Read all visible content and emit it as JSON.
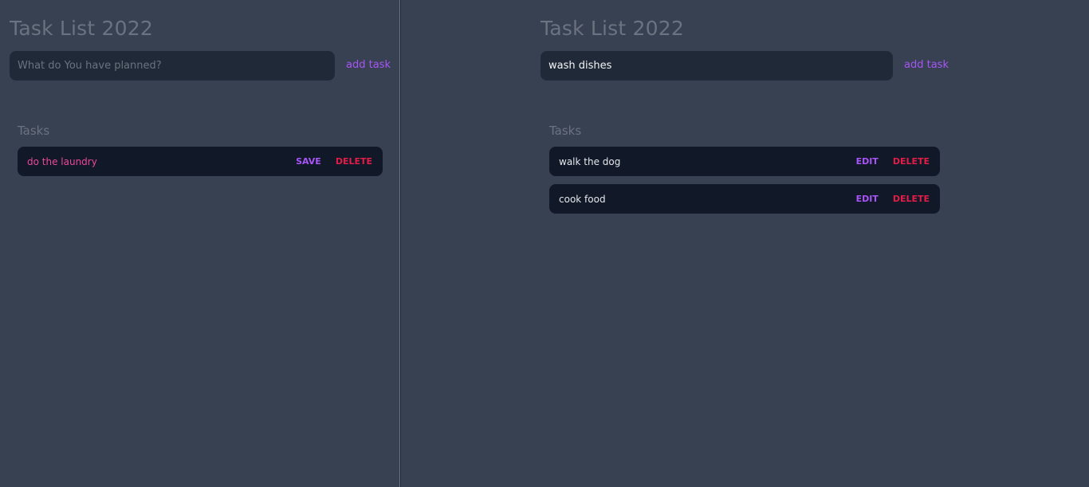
{
  "left": {
    "title": "Task List 2022",
    "input": {
      "value": "",
      "placeholder": "What do You have planned?"
    },
    "add_label": "add task",
    "section_label": "Tasks",
    "tasks": [
      {
        "text": "do the laundry",
        "primary_label": "SAVE",
        "delete_label": "DELETE"
      }
    ]
  },
  "right": {
    "title": "Task List 2022",
    "input": {
      "value": "wash dishes",
      "placeholder": ""
    },
    "add_label": "add task",
    "section_label": "Tasks",
    "tasks": [
      {
        "text": "walk the dog",
        "primary_label": "EDIT",
        "delete_label": "DELETE"
      },
      {
        "text": "cook food",
        "primary_label": "EDIT",
        "delete_label": "DELETE"
      }
    ]
  },
  "colors": {
    "background": "#374151",
    "input_bg": "#1f2937",
    "row_bg": "#111827",
    "accent_purple": "#a855f7",
    "delete_red": "#e11d48",
    "editing_pink": "#ec4899",
    "muted_text": "#6b7280"
  }
}
